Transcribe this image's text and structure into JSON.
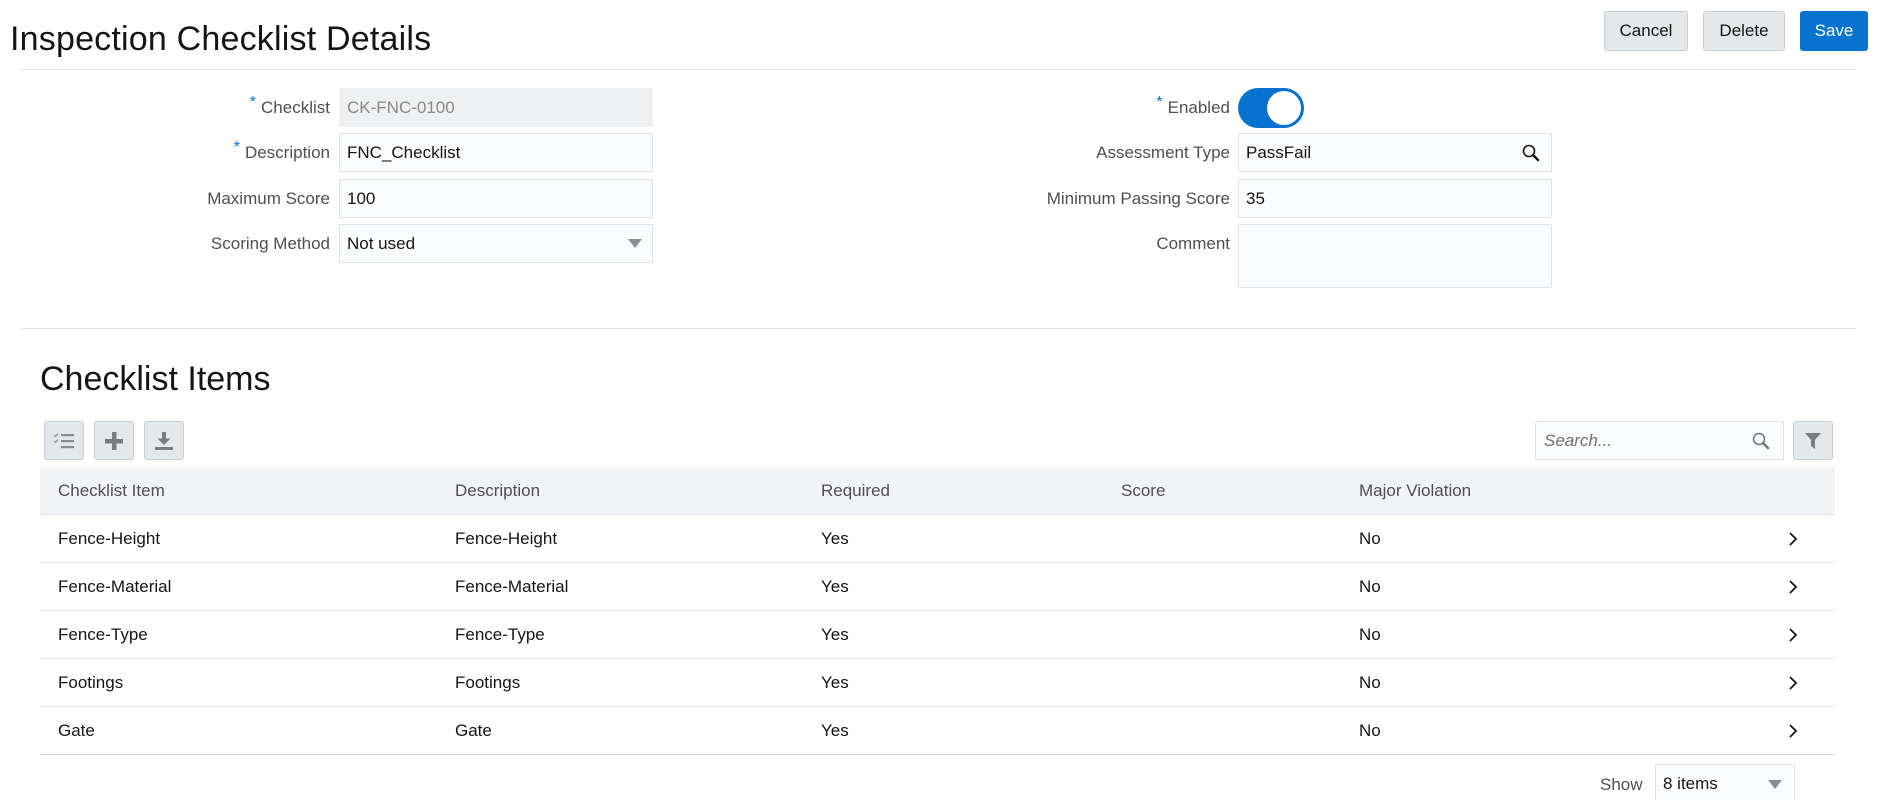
{
  "header": {
    "title": "Inspection Checklist Details",
    "buttons": {
      "cancel": "Cancel",
      "delete": "Delete",
      "save": "Save"
    }
  },
  "form": {
    "required_marker": "*",
    "checklist": {
      "label": "Checklist",
      "value": "CK-FNC-0100",
      "required": true,
      "readonly": true
    },
    "description": {
      "label": "Description",
      "value": "FNC_Checklist",
      "required": true
    },
    "maximum_score": {
      "label": "Maximum Score",
      "value": "100"
    },
    "scoring_method": {
      "label": "Scoring Method",
      "value": "Not used"
    },
    "enabled": {
      "label": "Enabled",
      "value": true,
      "required": true
    },
    "assessment_type": {
      "label": "Assessment Type",
      "value": "PassFail"
    },
    "minimum_passing_score": {
      "label": "Minimum Passing Score",
      "value": "35"
    },
    "comment": {
      "label": "Comment",
      "value": ""
    }
  },
  "items_section": {
    "title": "Checklist Items",
    "toolbar": [
      "checklist-icon",
      "add-icon",
      "download-icon"
    ],
    "search": {
      "placeholder": "Search...",
      "value": ""
    },
    "columns": [
      "Checklist Item",
      "Description",
      "Required",
      "Score",
      "Major Violation"
    ],
    "rows": [
      {
        "item": "Fence-Height",
        "description": "Fence-Height",
        "required": "Yes",
        "score": "",
        "major_violation": "No"
      },
      {
        "item": "Fence-Material",
        "description": "Fence-Material",
        "required": "Yes",
        "score": "",
        "major_violation": "No"
      },
      {
        "item": "Fence-Type",
        "description": "Fence-Type",
        "required": "Yes",
        "score": "",
        "major_violation": "No"
      },
      {
        "item": "Footings",
        "description": "Footings",
        "required": "Yes",
        "score": "",
        "major_violation": "No"
      },
      {
        "item": "Gate",
        "description": "Gate",
        "required": "Yes",
        "score": "",
        "major_violation": "No"
      }
    ],
    "pagination": {
      "show_label": "Show",
      "page_size": "8 items"
    }
  },
  "colors": {
    "accent": "#0572ce",
    "header_bg": "#f1f3f6",
    "border": "#dfe4e9"
  }
}
